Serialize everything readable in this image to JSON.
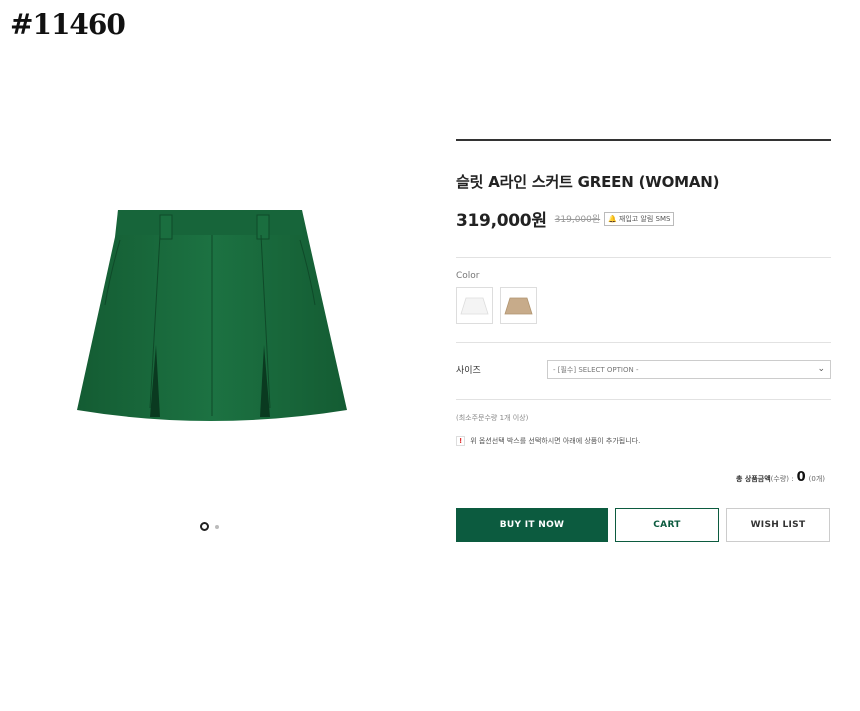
{
  "product_id": "#11460",
  "product": {
    "title": "슬릿 A라인 스커트 GREEN (WOMAN)",
    "price": "319,000원",
    "original_price": "319,000원",
    "restock_label": "재입고 알림 SMS"
  },
  "color": {
    "label": "Color",
    "swatches": [
      "white",
      "beige"
    ]
  },
  "size": {
    "label": "사이즈",
    "select_value": "- [필수] SELECT OPTION -"
  },
  "min_qty_text": "(최소주문수량 1개 이상)",
  "notice": {
    "icon": "!",
    "text": "위 옵션선택 박스를 선택하시면 아래에 상품이 추가됩니다."
  },
  "total": {
    "label": "총 상품금액",
    "sub": "(수량) :",
    "amount": "0",
    "count": "(0개)"
  },
  "buttons": {
    "buy": "BUY IT NOW",
    "cart": "CART",
    "wish": "WISH LIST"
  },
  "gallery": {
    "current_image": 1,
    "total_images": 2
  },
  "colors": {
    "accent": "#0c5b3f",
    "skirt": "#1a6e3e"
  }
}
